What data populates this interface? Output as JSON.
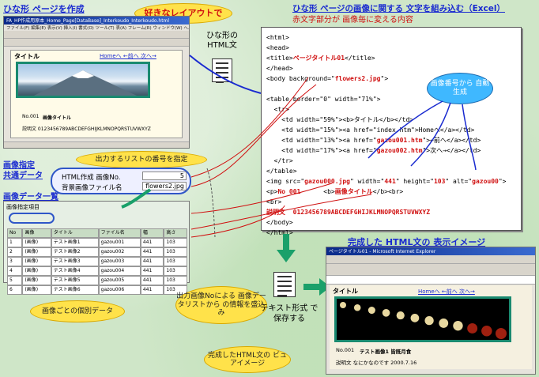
{
  "labels": {
    "template_create": "ひな形 ページを作成",
    "free_layout": "好きなレイアウトで",
    "template_html": "ひな形の HTML文",
    "embed_title": "ひな形 ページの画像に関する 文字を組み込む（Excel）",
    "red_note": "赤文字部分が 画像毎に変える内容",
    "auto_number": "画像番号から 自動生成",
    "image_spec": "画像指定",
    "common_data": "共通データ",
    "list_number": "出力するリストの番号を指定",
    "image_data_list": "画像データ一覧",
    "completed_title": "完成した HTML文の 表示イメージ",
    "per_image_data": "画像ごとの個別データ",
    "embed_info": "出力画像Noによる 画像データリストから の情報を盛込み",
    "text_save": "テキスト形式 で保存する",
    "viewer_image": "完成したHTML文の ビュアイメージ"
  },
  "common_fields": [
    {
      "label": "HTML作成 画像No.",
      "value": "5"
    },
    {
      "label": "背景画像ファイル名",
      "value": "flowers2.jpg"
    }
  ],
  "code_lines": [
    [
      {
        "t": "<html>"
      }
    ],
    [
      {
        "t": "<head>"
      }
    ],
    [
      {
        "t": "<title>"
      },
      {
        "t": "ページタイトル01",
        "r": true
      },
      {
        "t": "</title>"
      }
    ],
    [
      {
        "t": "</head>"
      }
    ],
    [
      {
        "t": "<body background=\""
      },
      {
        "t": "flowers2.jpg",
        "r": true
      },
      {
        "t": "\">"
      }
    ],
    [
      {
        "t": ""
      }
    ],
    [
      {
        "t": "<table border=\"0\" width=\"71%\">"
      }
    ],
    [
      {
        "t": "  <tr>"
      }
    ],
    [
      {
        "t": "    <td width=\"59%\"><b>タイトル</b></td>"
      }
    ],
    [
      {
        "t": "    <td width=\"15%\"><a href=\"index.htm\">Homeへ</a></td>"
      }
    ],
    [
      {
        "t": "    <td width=\"13%\"><a href=\""
      },
      {
        "t": "gazou001.htm",
        "r": true
      },
      {
        "t": "\">←前へ</a></td>"
      }
    ],
    [
      {
        "t": "    <td width=\"17%\"><a href=\""
      },
      {
        "t": "gazou002.htm",
        "r": true
      },
      {
        "t": "\">次へ→</a></td>"
      }
    ],
    [
      {
        "t": "  </tr>"
      }
    ],
    [
      {
        "t": "</table>"
      }
    ],
    [
      {
        "t": "<img src=\""
      },
      {
        "t": "gazou000.jpg",
        "r": true
      },
      {
        "t": "\" width=\""
      },
      {
        "t": "441",
        "r": true
      },
      {
        "t": "\" height=\""
      },
      {
        "t": "103",
        "r": true
      },
      {
        "t": "\" alt=\""
      },
      {
        "t": "gazou00",
        "r": true
      },
      {
        "t": "\">"
      }
    ],
    [
      {
        "t": "<p>"
      },
      {
        "t": "No 001",
        "r": true
      },
      {
        "t": "      <b>"
      },
      {
        "t": "画像タイトル",
        "r": true
      },
      {
        "t": "</b><br>"
      }
    ],
    [
      {
        "t": "<br>"
      }
    ],
    [
      {
        "t": "説明文  0123456789ABCDEFGHIJKLMNOPQRSTUVWXYZ",
        "r": true
      }
    ],
    [
      {
        "t": "</body>"
      }
    ],
    [
      {
        "t": "</html>"
      }
    ]
  ],
  "top_window": {
    "titlebar": "FA_HP作成用原本_Home_Page[DataBase]_Interkoudo_Interkoudo.html",
    "menu": "ファイル(F) 編集(E) 表示(V) 挿入(I) 書式(O) ツール(T) 表(A) フレーム(R) ウィンドウ(W) ヘルプ(H)",
    "page_title": "タイトル",
    "nav": "Homeへ ←前へ 次へ→",
    "no": "No.001",
    "img_title": "画像タイトル",
    "desc": "説明文 0123456789ABCDEFGHIJKLMNOPQRSTUVWXYZ"
  },
  "sheet": {
    "title": "画像指定項目",
    "headers": [
      "No",
      "画像",
      "タイトル",
      "ファイル名",
      "幅",
      "高さ"
    ],
    "rows": [
      [
        "1",
        "(画像)",
        "テスト画像1",
        "gazou001",
        "441",
        "103"
      ],
      [
        "2",
        "(画像)",
        "テスト画像2",
        "gazou002",
        "441",
        "103"
      ],
      [
        "3",
        "(画像)",
        "テスト画像3",
        "gazou003",
        "441",
        "103"
      ],
      [
        "4",
        "(画像)",
        "テスト画像4",
        "gazou004",
        "441",
        "103"
      ],
      [
        "5",
        "(画像)",
        "テスト画像5",
        "gazou005",
        "441",
        "103"
      ],
      [
        "6",
        "(画像)",
        "テスト画像6",
        "gazou006",
        "441",
        "103"
      ]
    ]
  },
  "browser": {
    "titlebar": "ページタイトル01 - Microsoft Internet Explorer",
    "page_title": "タイトル",
    "nav": "Homeへ ←前へ 次へ→",
    "no": "No.001",
    "img_title": "テスト画像1 皆既月食",
    "desc": "説明文 なにかなのです 2000.7.16"
  },
  "colors": {
    "bubble": "#ffe24a",
    "bubble_blue": "#3fb8ff",
    "title_blue": "#1a2bd0",
    "red": "#d01010",
    "bg": "#cfe6c8"
  }
}
